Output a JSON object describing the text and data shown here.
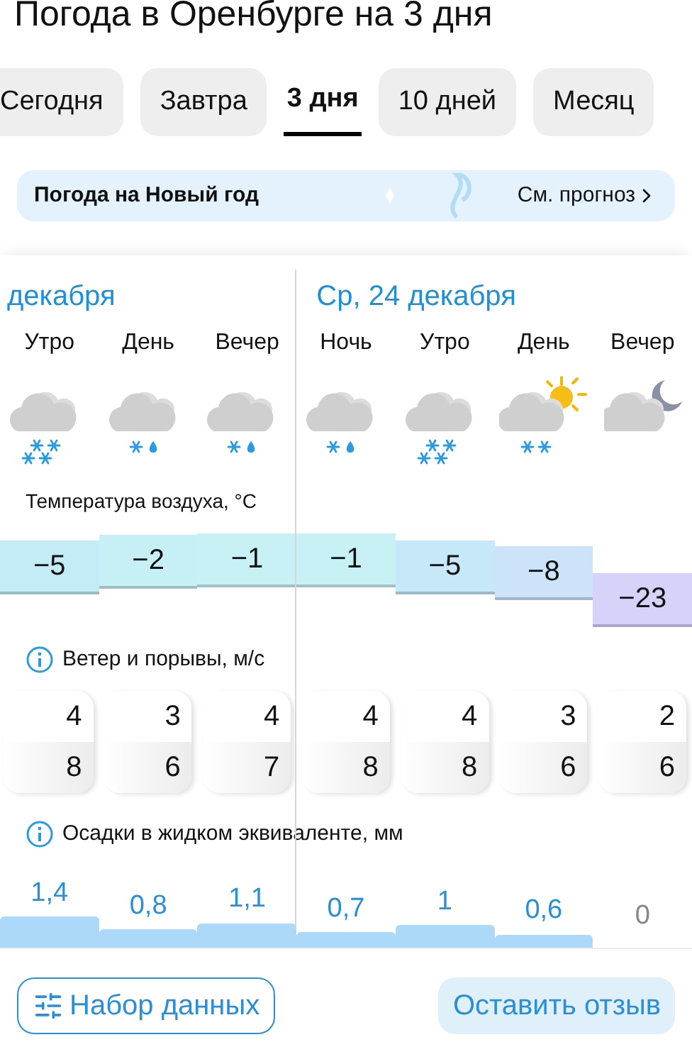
{
  "title": "Погода в Оренбурге на 3 дня",
  "tabs": [
    {
      "label": "Сегодня",
      "selected": false
    },
    {
      "label": "Завтра",
      "selected": false
    },
    {
      "label": "3 дня",
      "selected": true
    },
    {
      "label": "10 дней",
      "selected": false
    },
    {
      "label": "Месяц",
      "selected": false
    }
  ],
  "banner": {
    "title": "Погода на Новый год",
    "link": "См. прогноз"
  },
  "temperature_label": "Температура воздуха, °C",
  "wind_label": "Ветер и порывы, м/с",
  "precipitation_label": "Осадки в жидком эквиваленте, мм",
  "days": [
    {
      "label": "декабря",
      "periods": [
        {
          "name": "Утро",
          "kind": "heavy_snow",
          "temperature": {
            "value": "−5",
            "color": "#c3ecf7"
          },
          "wind": {
            "speed": "4",
            "gust": "8"
          },
          "precipitation": {
            "value": "1,4"
          }
        },
        {
          "name": "День",
          "kind": "sleet",
          "temperature": {
            "value": "−2",
            "color": "#c6eff6"
          },
          "wind": {
            "speed": "3",
            "gust": "6"
          },
          "precipitation": {
            "value": "0,8"
          }
        },
        {
          "name": "Вечер",
          "kind": "sleet",
          "temperature": {
            "value": "−1",
            "color": "#c8f1f5"
          },
          "wind": {
            "speed": "4",
            "gust": "7"
          },
          "precipitation": {
            "value": "1,1"
          }
        }
      ]
    },
    {
      "label": "Ср, 24 декабря",
      "periods": [
        {
          "name": "Ночь",
          "kind": "sleet",
          "temperature": {
            "value": "−1",
            "color": "#c8f1f5"
          },
          "wind": {
            "speed": "4",
            "gust": "8"
          },
          "precipitation": {
            "value": "0,7"
          }
        },
        {
          "name": "Утро",
          "kind": "heavy_snow",
          "temperature": {
            "value": "−5",
            "color": "#c6e8f9"
          },
          "wind": {
            "speed": "4",
            "gust": "8"
          },
          "precipitation": {
            "value": "1"
          }
        },
        {
          "name": "День",
          "kind": "sun_snow",
          "temperature": {
            "value": "−8",
            "color": "#cde3fa"
          },
          "wind": {
            "speed": "3",
            "gust": "6"
          },
          "precipitation": {
            "value": "0,6"
          }
        },
        {
          "name": "Вечер",
          "kind": "moon_cloud",
          "temperature": {
            "value": "−23",
            "color": "#d5d3fa"
          },
          "wind": {
            "speed": "2",
            "gust": "6"
          },
          "precipitation": {
            "value": "0"
          }
        }
      ]
    }
  ],
  "dataset_button": "Набор данных",
  "feedback_button": "Оставить отзыв"
}
